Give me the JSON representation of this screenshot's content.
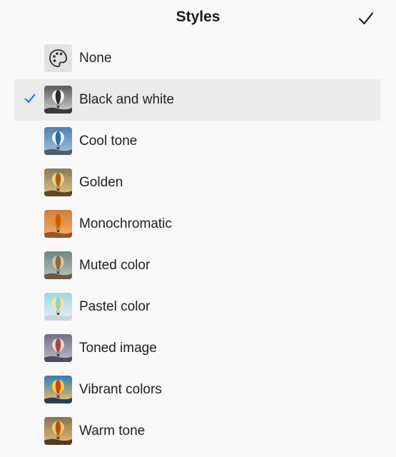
{
  "header": {
    "title": "Styles",
    "confirm_icon": "checkmark-icon"
  },
  "accent_color": "#1473e6",
  "styles": [
    {
      "label": "None",
      "icon": "palette-icon",
      "selected": false
    },
    {
      "label": "Black and white",
      "icon": "balloon-thumbnail",
      "selected": true,
      "sky_top": "#5a5a5a",
      "sky_bottom": "#d8d8d8",
      "ground": "#3a3a3a",
      "balloon_a": "#f2f2f2",
      "balloon_b": "#2a2a2a"
    },
    {
      "label": "Cool tone",
      "icon": "balloon-thumbnail",
      "selected": false,
      "sky_top": "#4f7fb0",
      "sky_bottom": "#a9c3dc",
      "ground": "#4c5d72",
      "balloon_a": "#e7eef5",
      "balloon_b": "#2f6aa1"
    },
    {
      "label": "Golden",
      "icon": "balloon-thumbnail",
      "selected": false,
      "sky_top": "#8a7a57",
      "sky_bottom": "#e6c587",
      "ground": "#5c4a2c",
      "balloon_a": "#f1d17c",
      "balloon_b": "#a55f1c"
    },
    {
      "label": "Monochromatic",
      "icon": "balloon-thumbnail",
      "selected": false,
      "sky_top": "#d27d3a",
      "sky_bottom": "#f1b070",
      "ground": "#9a5526",
      "balloon_a": "#f08a2c",
      "balloon_b": "#c25a14"
    },
    {
      "label": "Muted color",
      "icon": "balloon-thumbnail",
      "selected": false,
      "sky_top": "#6e8584",
      "sky_bottom": "#b8c4bd",
      "ground": "#6a5a46",
      "balloon_a": "#d8c29a",
      "balloon_b": "#8a6a4b"
    },
    {
      "label": "Pastel color",
      "icon": "balloon-thumbnail",
      "selected": false,
      "sky_top": "#9fd6df",
      "sky_bottom": "#e6f1f3",
      "ground": "#c9d7dc",
      "balloon_a": "#f6e3a6",
      "balloon_b": "#9fcfc4"
    },
    {
      "label": "Toned image",
      "icon": "balloon-thumbnail",
      "selected": false,
      "sky_top": "#6d6f86",
      "sky_bottom": "#bfbcc7",
      "ground": "#4e4d5c",
      "balloon_a": "#ead9b1",
      "balloon_b": "#a0435a"
    },
    {
      "label": "Vibrant colors",
      "icon": "balloon-thumbnail",
      "selected": false,
      "sky_top": "#2f7db6",
      "sky_bottom": "#f4c165",
      "ground": "#2c3a52",
      "balloon_a": "#ffd52d",
      "balloon_b": "#d3402a"
    },
    {
      "label": "Warm tone",
      "icon": "balloon-thumbnail",
      "selected": false,
      "sky_top": "#8a7152",
      "sky_bottom": "#e5bd80",
      "ground": "#4f3a22",
      "balloon_a": "#f5c662",
      "balloon_b": "#b1541c"
    }
  ]
}
